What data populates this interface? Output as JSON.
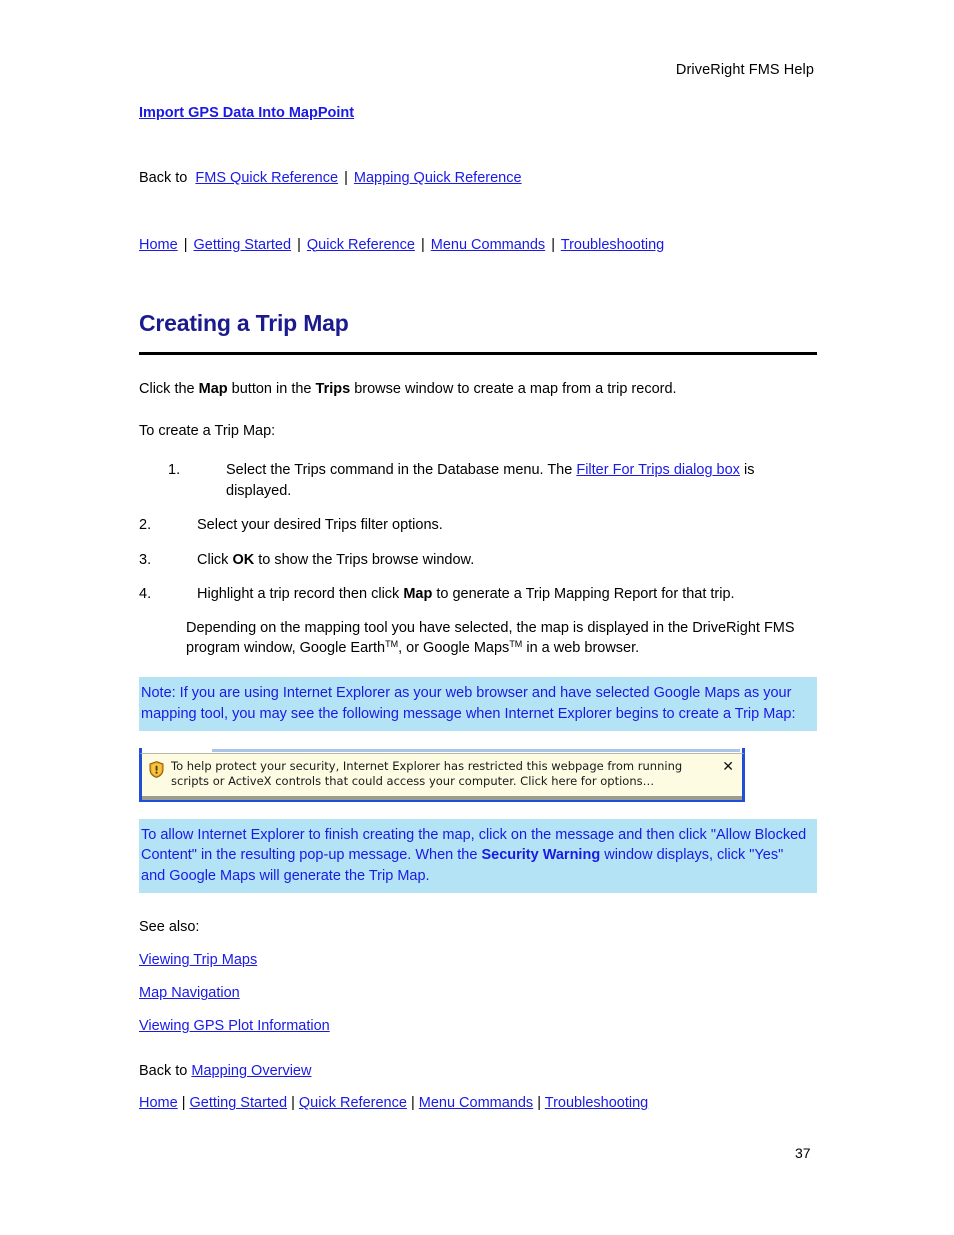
{
  "header": {
    "running_head": "DriveRight FMS Help"
  },
  "top": {
    "topic_link": "Import GPS Data Into MapPoint",
    "back_to_label": "Back to",
    "back_to_links": [
      "FMS Quick Reference",
      "Mapping Quick Reference"
    ],
    "separator": "|"
  },
  "nav": {
    "items": [
      "Home",
      "Getting Started",
      "Quick Reference",
      "Menu Commands",
      "Troubleshooting"
    ],
    "separator": "|"
  },
  "section": {
    "title": "Creating a Trip Map",
    "intro_before_map": "Click the ",
    "intro_map": "Map",
    "intro_mid": " button in the ",
    "intro_trips": "Trips",
    "intro_after": " browse window to create a map from a trip record.",
    "lead_in": "To create a Trip Map:"
  },
  "steps": [
    {
      "marker": "1.",
      "text_before_link": "Select the Trips command in the Database menu. The ",
      "link": "Filter For Trips dialog box",
      "text_after_link": " is displayed."
    },
    {
      "marker": "2.",
      "text": "Select your desired Trips filter options."
    },
    {
      "marker": "3.",
      "text_before_bold": "Click ",
      "bold": "OK",
      "text_after_bold": " to show the Trips browse window."
    },
    {
      "marker": "4.",
      "text_before_bold": "Highlight a trip record then click ",
      "bold": "Map",
      "text_after_bold": " to generate a Trip Mapping Report for that trip."
    }
  ],
  "sub_paragraph": {
    "part1": "Depending on the mapping tool you have selected, the map is displayed in the DriveRight FMS program window, Google Earth",
    "tm1": "TM",
    "part2": ", or Google Maps",
    "tm2": "TM",
    "part3": " in a web browser."
  },
  "note_top": {
    "text": "Note: If you are using Internet Explorer as your web browser and have selected Google Maps as your mapping tool, you may see the following message when Internet Explorer begins to create a Trip Map:"
  },
  "ie_bar": {
    "icon": "shield-warning-icon",
    "line1": "To help protect your security, Internet Explorer has restricted this webpage from running",
    "line2": "scripts or ActiveX controls that could access your computer. Click here for options…",
    "close_label": "✕"
  },
  "note_bottom": {
    "part1": "To allow Internet Explorer to finish creating the map, click on the message and then click \"Allow Blocked Content\" in the resulting pop-up message. When the ",
    "bold": "Security Warning",
    "part2": " window displays, click \"Yes\" and Google Maps will generate the Trip Map."
  },
  "see_also": {
    "label": "See also:",
    "links": [
      "Viewing Trip Maps",
      "Map Navigation",
      "Viewing GPS Plot Information"
    ]
  },
  "footer": {
    "back_to_label": "Back to",
    "back_to_link": "Mapping Overview",
    "page_number": "37"
  },
  "colors": {
    "link": "#1a1ae6",
    "heading": "#1b1b8f",
    "note_background": "#b3e3f5",
    "ie_bar_background": "#fdfbe2",
    "ie_bar_border": "#1f4fd8"
  }
}
